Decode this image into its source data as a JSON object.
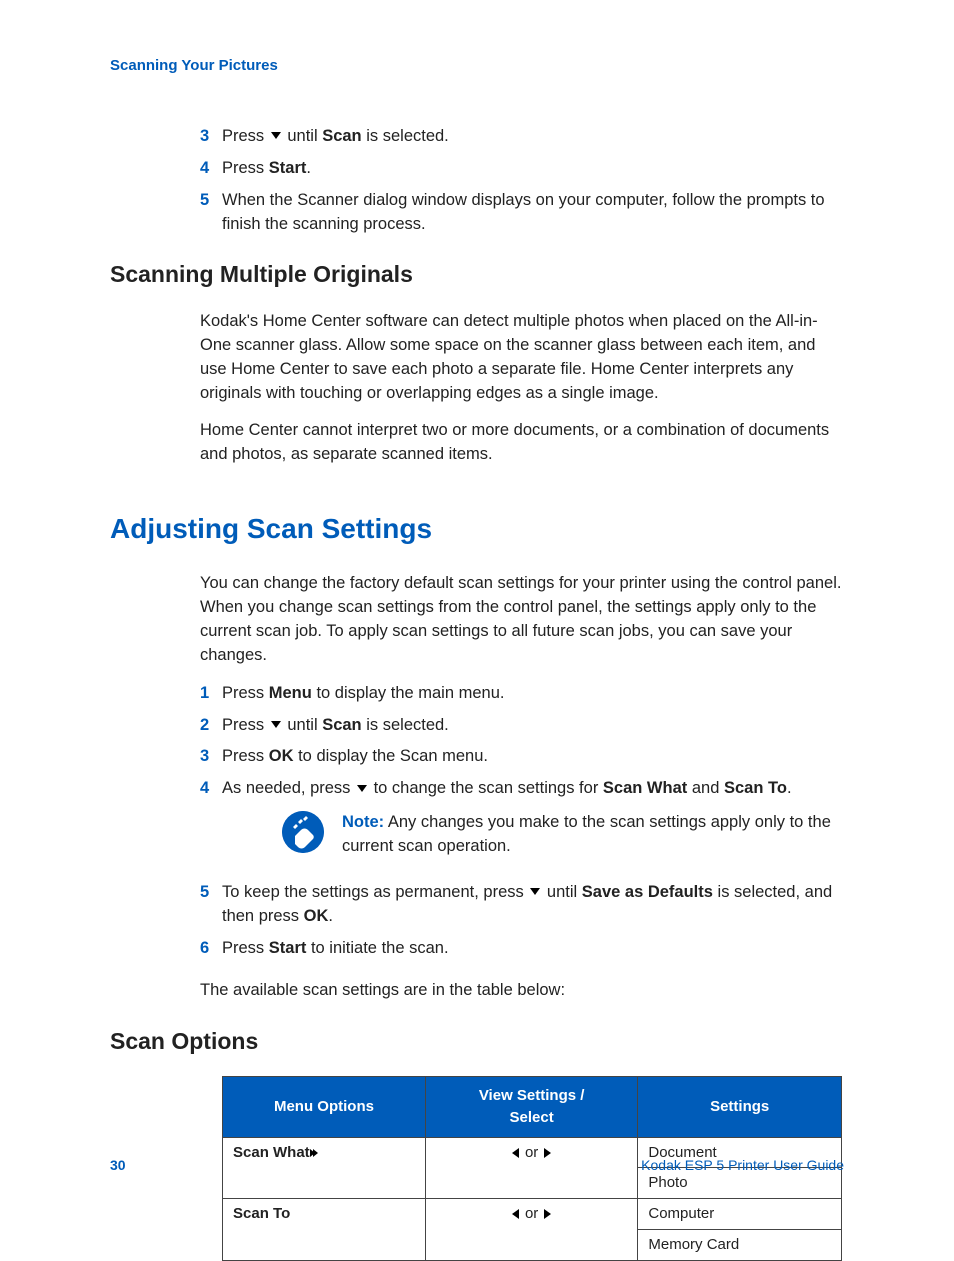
{
  "header": {
    "running": "Scanning Your Pictures"
  },
  "stepsA": {
    "s3_pre": "Press ",
    "s3_post": " until ",
    "s3_bold": "Scan",
    "s3_end": " is selected.",
    "s4_pre": "Press ",
    "s4_bold": "Start",
    "s4_end": ".",
    "s5": "When the Scanner dialog window displays on your computer, follow the prompts to finish the scanning process."
  },
  "h_multi": "Scanning Multiple Originals",
  "multi_p1": "Kodak's Home Center software can detect multiple photos when placed on the All-in-One scanner glass. Allow some space on the scanner glass between each item, and use Home Center to save each photo a separate file. Home Center interprets any originals with touching or overlapping edges as a single image.",
  "multi_p2": "Home Center cannot interpret two or more documents, or a combination of documents and photos, as separate scanned items.",
  "h_adjust": "Adjusting Scan Settings",
  "adjust_p1": "You can change the factory default scan settings for your printer using the control panel. When you change scan settings from the control panel, the settings apply only to the current scan job. To apply scan settings to all future scan jobs, you can save your changes.",
  "stepsB": {
    "s1_pre": "Press ",
    "s1_bold": "Menu",
    "s1_end": " to display the main menu.",
    "s2_pre": "Press ",
    "s2_post": " until ",
    "s2_bold": "Scan",
    "s2_end": " is selected.",
    "s3_pre": "Press ",
    "s3_bold": "OK",
    "s3_end": " to display the Scan menu.",
    "s4_pre": "As needed, press ",
    "s4_mid": " to change the scan settings for ",
    "s4_b1": "Scan What",
    "s4_and": " and ",
    "s4_b2": "Scan To",
    "s4_end": ".",
    "note_label": "Note:",
    "note_body": "  Any changes you make to the scan settings apply only to the current scan operation.",
    "s5_pre": "To keep the settings as permanent, press ",
    "s5_post": " until ",
    "s5_bold": "Save as Defaults",
    "s5_mid2": " is selected, and then press ",
    "s5_bold2": "OK",
    "s5_end": ".",
    "s6_pre": "Press ",
    "s6_bold": "Start",
    "s6_end": " to initiate the scan."
  },
  "avail_line": "The available scan settings are in the table below:",
  "h_scanopts": "Scan Options",
  "table": {
    "h1": "Menu Options",
    "h2a": "View Settings /",
    "h2b": "Select",
    "h3": "Settings",
    "r1_opt": "Scan What",
    "or": " or ",
    "r1_s1": "Document",
    "r1_s2": "Photo",
    "r2_opt": "Scan To",
    "r2_s1": "Computer",
    "r2_s2": "Memory Card"
  },
  "footer": {
    "page": "30",
    "guide": "Kodak ESP 5 Printer User Guide"
  },
  "nums": {
    "n1": "1",
    "n2": "2",
    "n3": "3",
    "n4": "4",
    "n5": "5",
    "n6": "6"
  }
}
